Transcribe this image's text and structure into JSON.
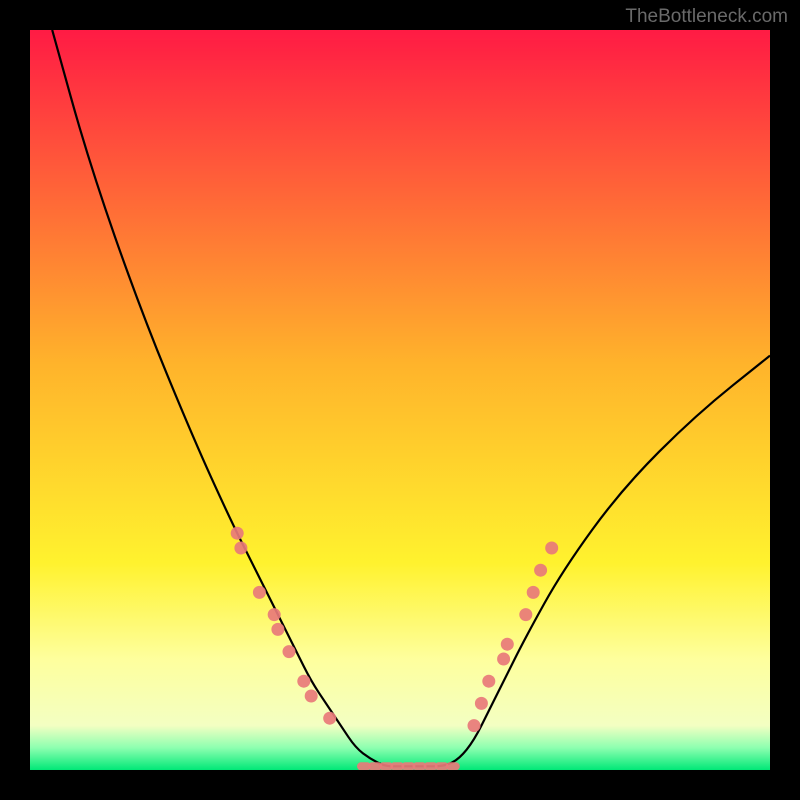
{
  "watermark": "TheBottleneck.com",
  "chart_data": {
    "type": "line",
    "title": "",
    "xlabel": "",
    "ylabel": "",
    "xlim": [
      0,
      100
    ],
    "ylim": [
      0,
      100
    ],
    "background_gradient": {
      "stops": [
        {
          "pct": 0,
          "color": "#ff1b44"
        },
        {
          "pct": 45,
          "color": "#ffb32b"
        },
        {
          "pct": 72,
          "color": "#fff22e"
        },
        {
          "pct": 85,
          "color": "#feff9d"
        },
        {
          "pct": 94,
          "color": "#f3ffc2"
        },
        {
          "pct": 97,
          "color": "#8dffb0"
        },
        {
          "pct": 100,
          "color": "#00e877"
        }
      ]
    },
    "series": [
      {
        "name": "curve",
        "type": "line",
        "x": [
          3,
          8,
          15,
          22,
          27,
          30,
          33,
          36,
          38,
          40,
          42,
          44,
          46,
          48,
          50,
          53,
          56,
          58,
          60,
          62,
          64,
          67,
          72,
          80,
          90,
          100
        ],
        "y": [
          100,
          82,
          62,
          45,
          34,
          28,
          22,
          16,
          12,
          9,
          6,
          3,
          1.5,
          0.5,
          0.5,
          0.5,
          0.5,
          1.5,
          4,
          8,
          12,
          18,
          27,
          38,
          48,
          56
        ]
      },
      {
        "name": "markers-left",
        "type": "scatter",
        "x": [
          28,
          28.5,
          31,
          33,
          33.5,
          35,
          37,
          38,
          40.5
        ],
        "y": [
          32,
          30,
          24,
          21,
          19,
          16,
          12,
          10,
          7
        ],
        "color": "#e87a7a"
      },
      {
        "name": "markers-valley",
        "type": "scatter",
        "x": [
          45,
          46.5,
          48,
          49.5,
          51,
          52.5,
          54,
          55.5,
          57
        ],
        "y": [
          0.5,
          0.5,
          0.5,
          0.5,
          0.5,
          0.5,
          0.5,
          0.5,
          0.5
        ],
        "color": "#e87a7a"
      },
      {
        "name": "markers-right",
        "type": "scatter",
        "x": [
          60,
          61,
          62,
          64,
          64.5,
          67,
          68,
          69,
          70.5
        ],
        "y": [
          6,
          9,
          12,
          15,
          17,
          21,
          24,
          27,
          30
        ],
        "color": "#e87a7a"
      }
    ]
  }
}
